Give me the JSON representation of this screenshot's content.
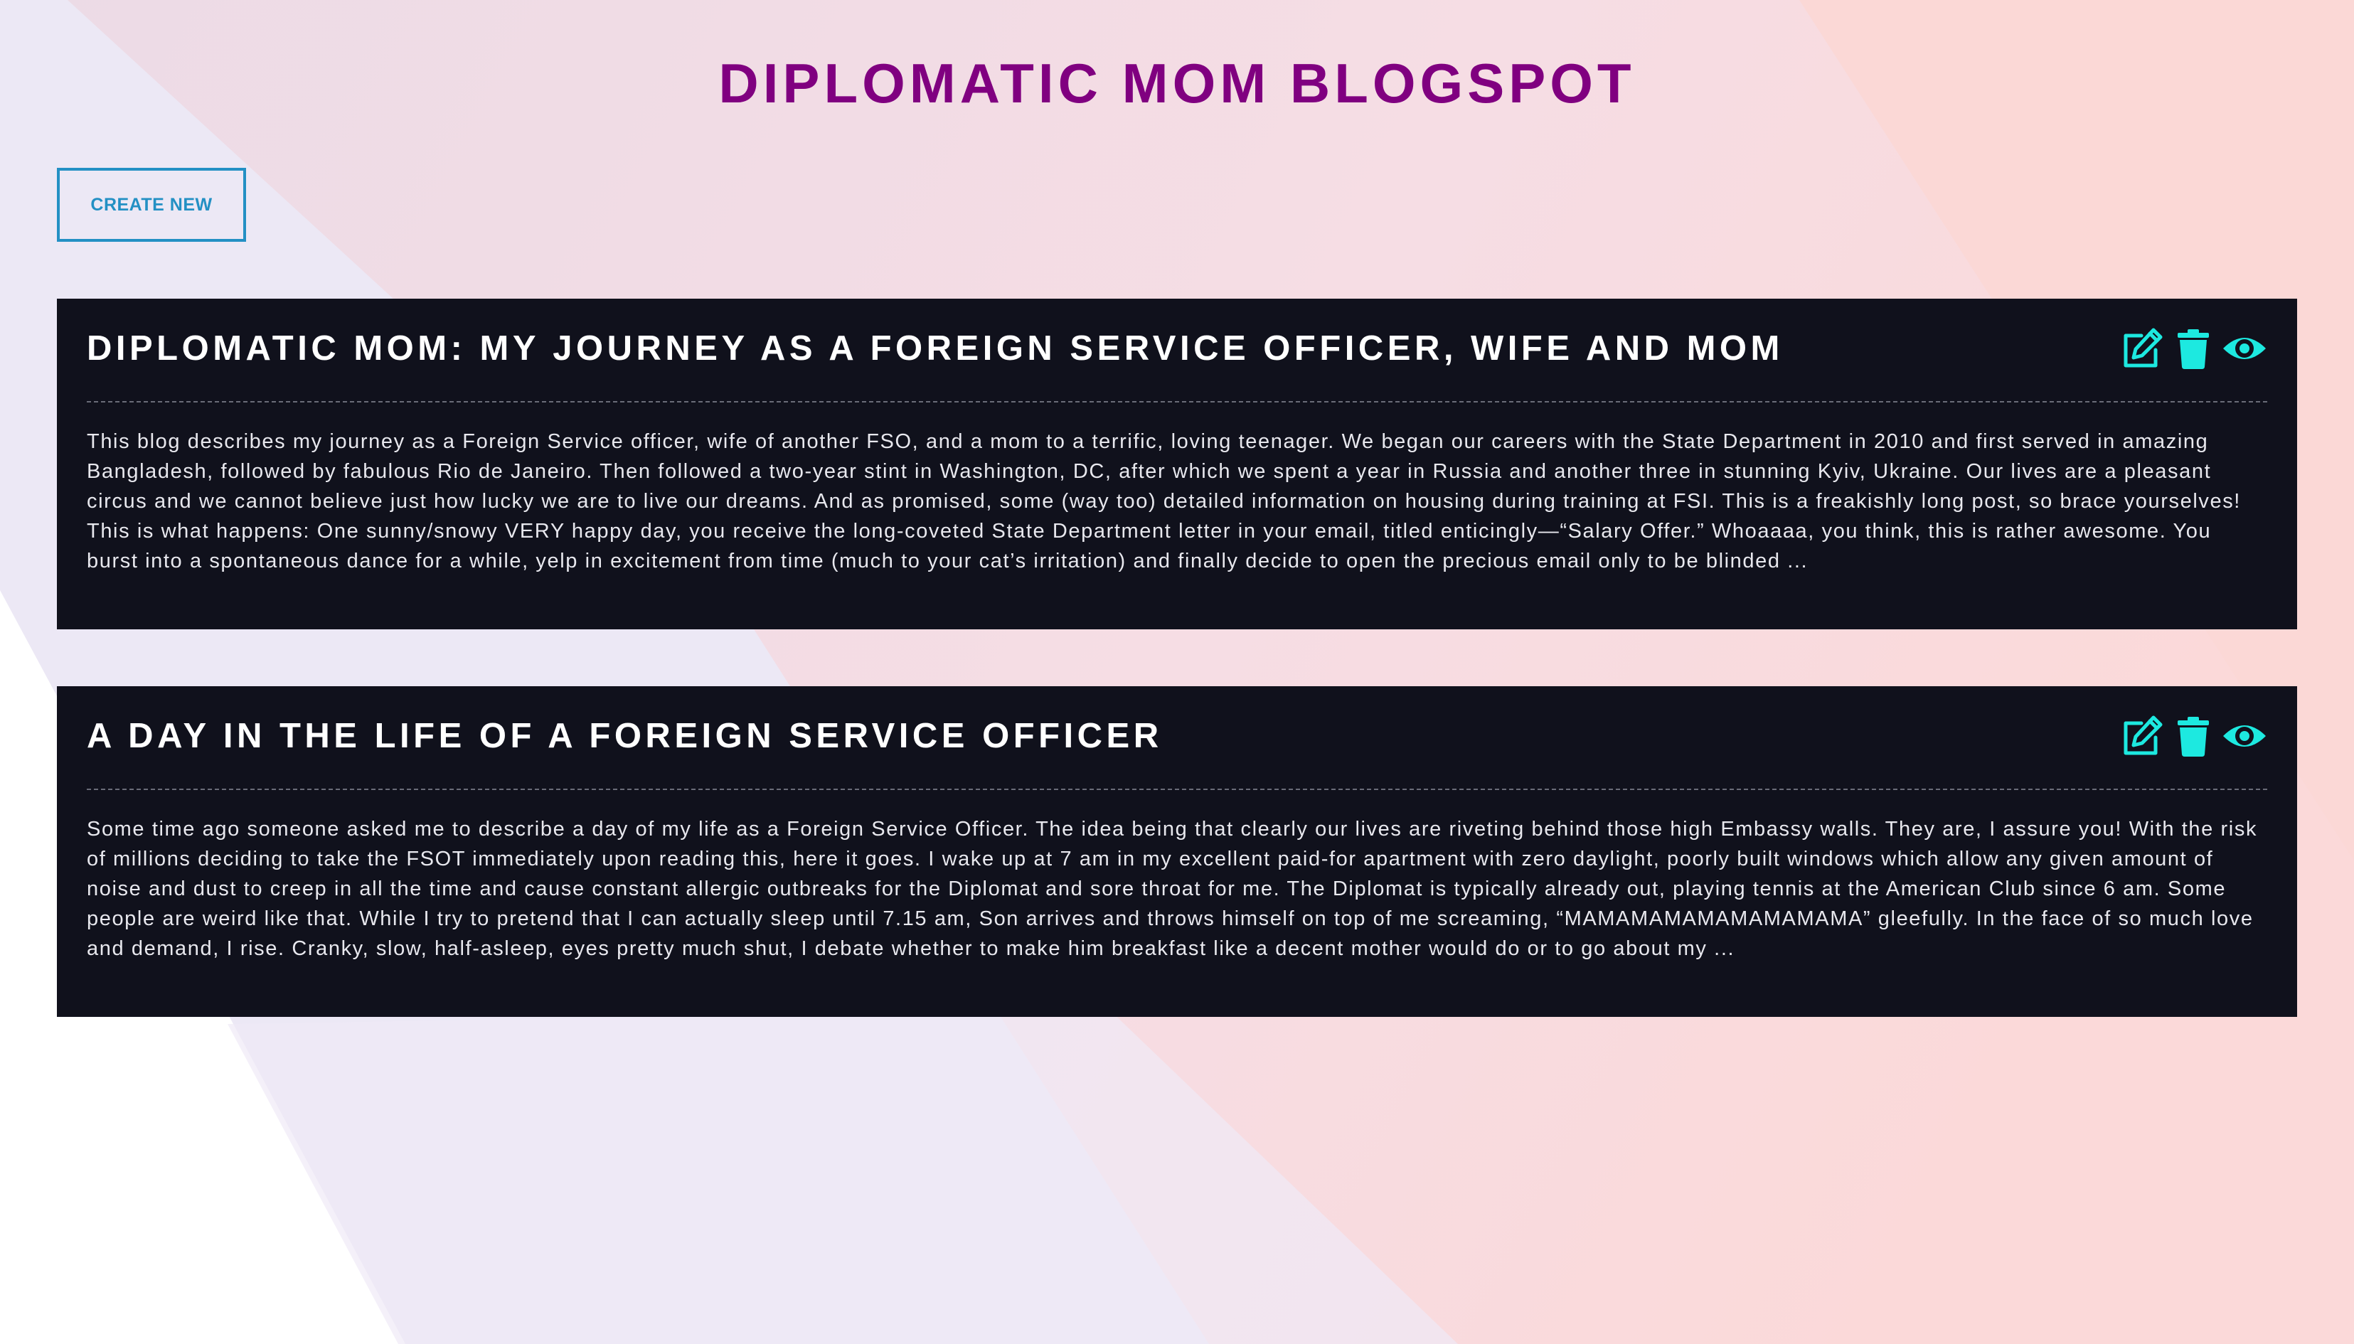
{
  "page": {
    "title": "DIPLOMATIC MOM BLOGSPOT",
    "create_button_label": "CREATE NEW"
  },
  "colors": {
    "title": "#800080",
    "create_button": "#2390c4",
    "card_background": "#10111c",
    "action_icons": "#1de9e0"
  },
  "posts": [
    {
      "title": "DIPLOMATIC MOM: MY JOURNEY AS A FOREIGN SERVICE OFFICER, WIFE AND MOM",
      "excerpt": "This blog describes my journey as a Foreign Service officer, wife of another FSO, and a mom to a terrific, loving teenager. We began our careers with the State Department in 2010 and first served in amazing Bangladesh, followed by fabulous Rio de Janeiro. Then followed a two-year stint in Washington, DC, after which we spent a year in Russia and another three in stunning Kyiv, Ukraine. Our lives are a pleasant circus and we cannot believe just how lucky we are to live our dreams. And as promised, some (way too) detailed information on housing during training at FSI. This is a freakishly long post, so brace yourselves! This is what happens: One sunny/snowy VERY happy day, you receive the long-coveted State Department letter in your email, titled enticingly—“Salary Offer.” Whoaaaa, you think, this is rather awesome. You burst into a spontaneous dance for a while, yelp in excitement from time (much to your cat’s irritation) and finally decide to open the precious email only to be blinded ...",
      "actions": [
        "edit-icon",
        "trash-icon",
        "eye-icon"
      ]
    },
    {
      "title": "A DAY IN THE LIFE OF A FOREIGN SERVICE OFFICER",
      "excerpt": "Some time ago someone asked me to describe a day of my life as a Foreign Service Officer. The idea being that clearly our lives are riveting behind those high Embassy walls. They are, I assure you! With the risk of millions deciding to take the FSOT immediately upon reading this, here it goes. I wake up at 7 am in my excellent paid-for apartment with zero daylight, poorly built windows which allow any given amount of noise and dust to creep in all the time and cause constant allergic outbreaks for the Diplomat and sore throat for me. The Diplomat is typically already out, playing tennis at the American Club since 6 am. Some people are weird like that. While I try to pretend that I can actually sleep until 7.15 am, Son arrives and throws himself on top of me screaming, “MAMAMAMAMAMAMAMAMA” gleefully. In the face of so much love and demand, I rise. Cranky, slow, half-asleep, eyes pretty much shut, I debate whether to make him breakfast like a decent mother would do or to go about my ...",
      "actions": [
        "edit-icon",
        "trash-icon",
        "eye-icon"
      ]
    }
  ]
}
